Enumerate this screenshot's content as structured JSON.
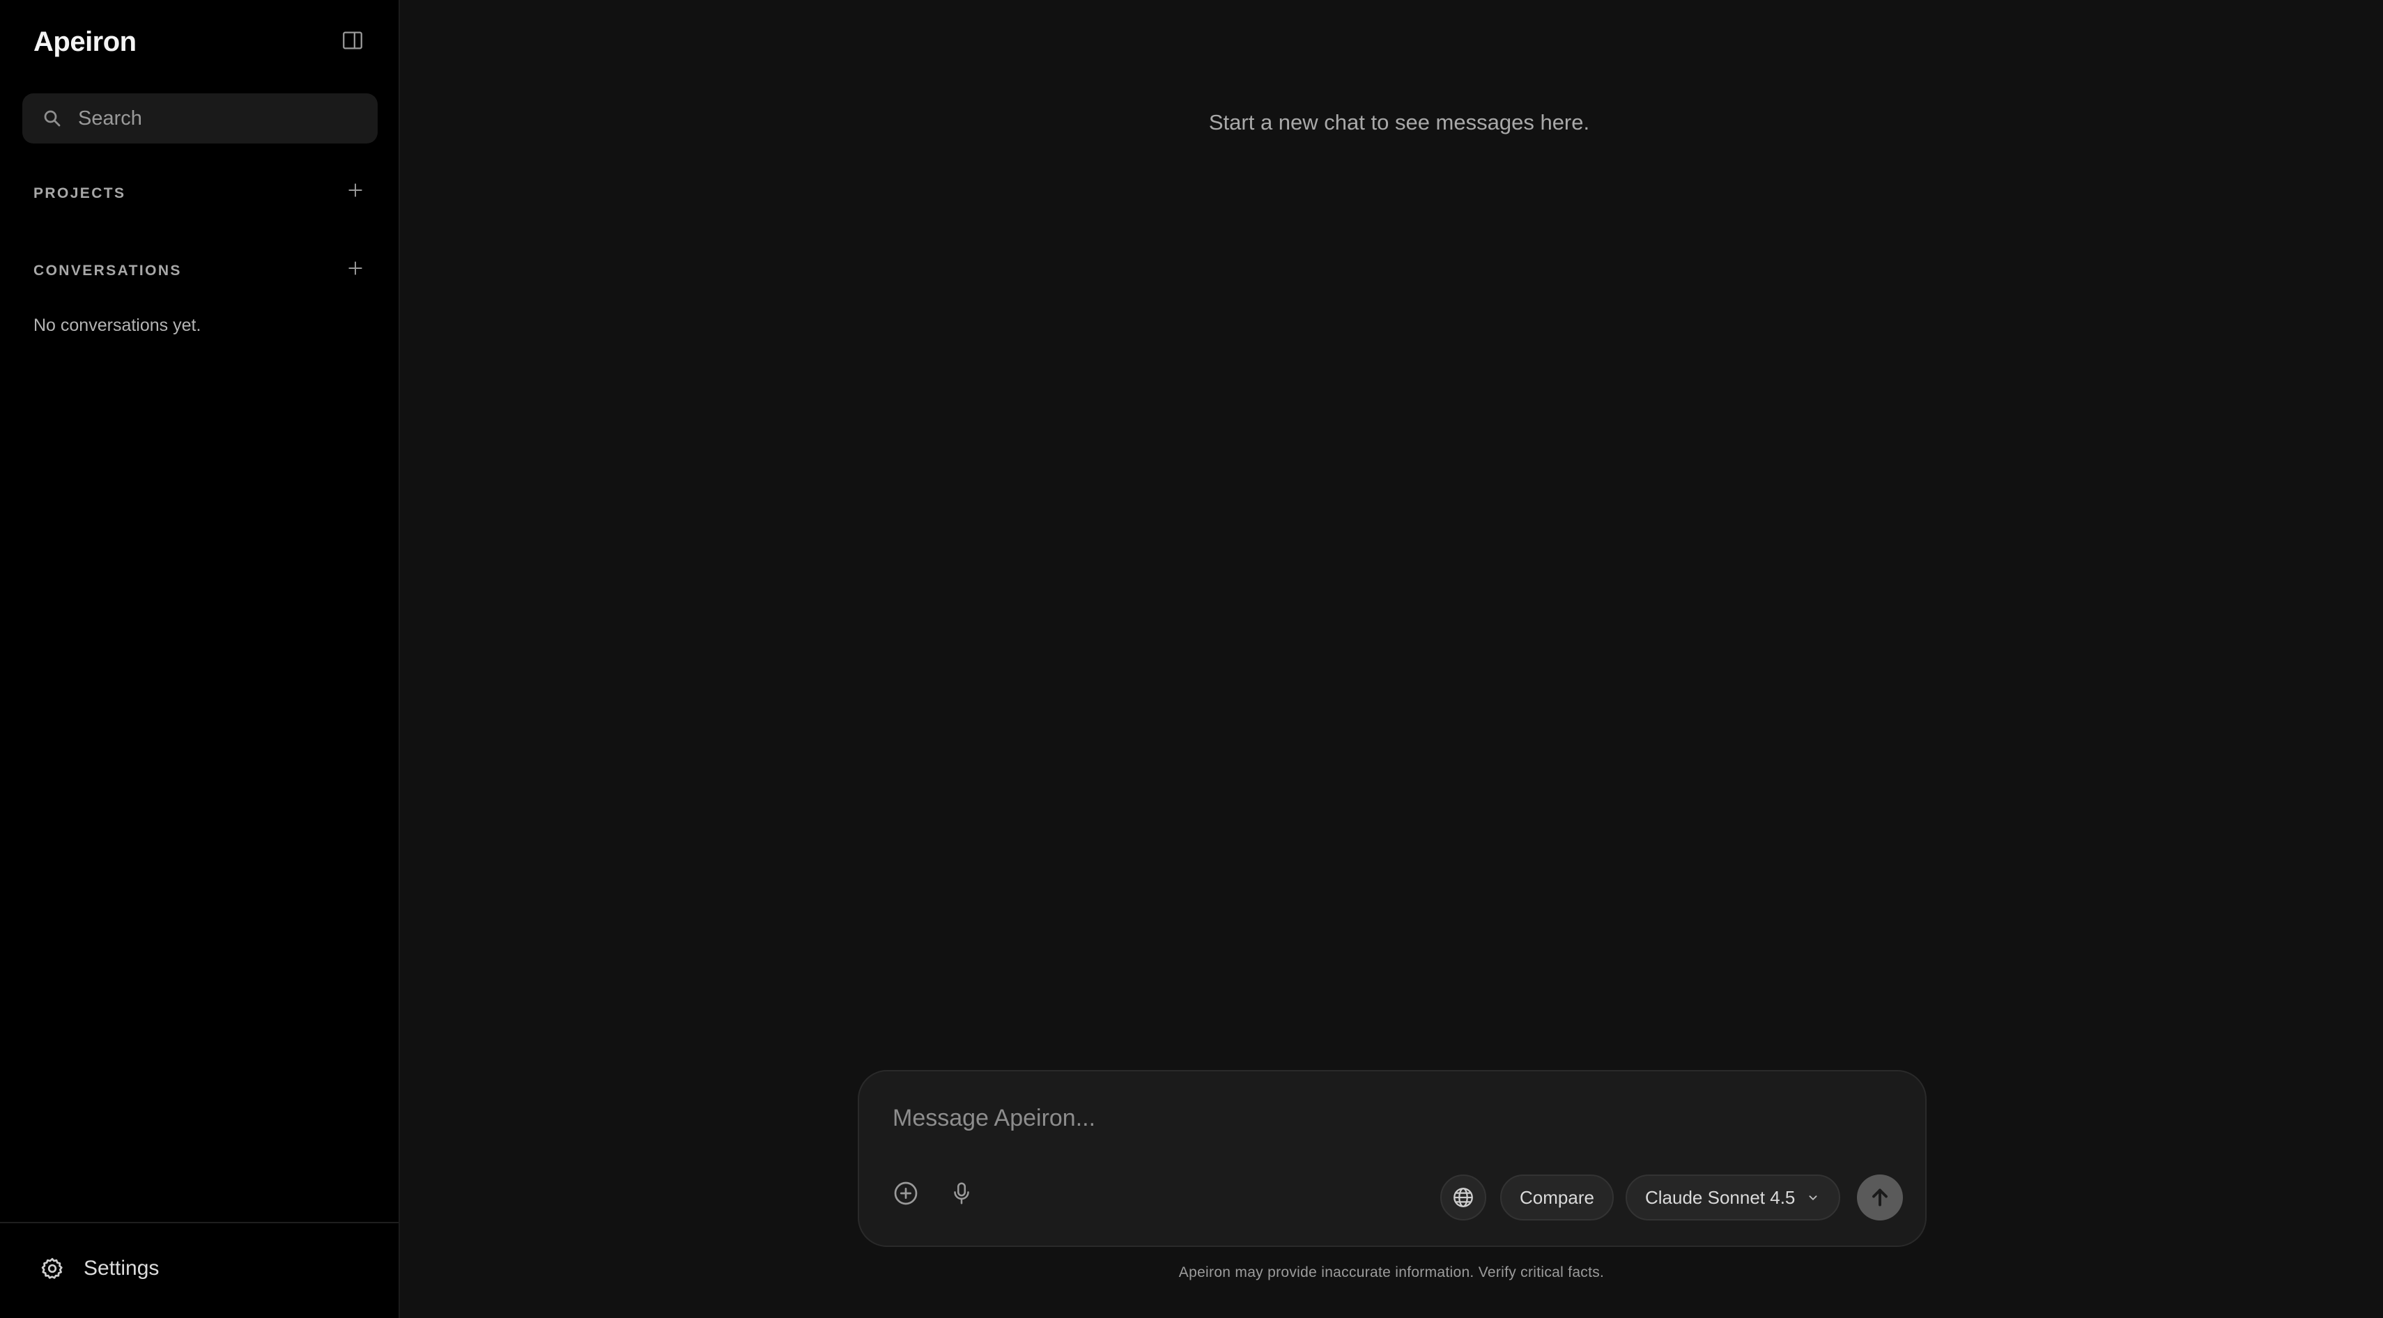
{
  "app": {
    "name": "Apeiron"
  },
  "sidebar": {
    "search": {
      "placeholder": "Search",
      "icon": "search-icon"
    },
    "sections": {
      "projects": {
        "label": "PROJECTS",
        "add_icon": "plus-icon"
      },
      "conversations": {
        "label": "CONVERSATIONS",
        "add_icon": "plus-icon",
        "empty_text": "No conversations yet."
      }
    },
    "footer": {
      "settings_label": "Settings",
      "settings_icon": "gear-icon"
    },
    "toggle_icon": "sidebar-toggle-icon"
  },
  "main": {
    "empty_state": "Start a new chat to see messages here.",
    "composer": {
      "placeholder": "Message Apeiron...",
      "attach_icon": "plus-circle-icon",
      "mic_icon": "microphone-icon",
      "web_icon": "globe-icon",
      "compare_label": "Compare",
      "model_label": "Claude Sonnet 4.5",
      "model_icon": "chevron-down-icon",
      "send_icon": "arrow-up-icon"
    },
    "disclaimer": "Apeiron may provide inaccurate information. Verify critical facts."
  },
  "colors": {
    "sidebar_bg": "#000000",
    "main_bg": "#111111",
    "composer_bg": "#1b1b1b",
    "send_button_bg": "#5a5a5a"
  }
}
